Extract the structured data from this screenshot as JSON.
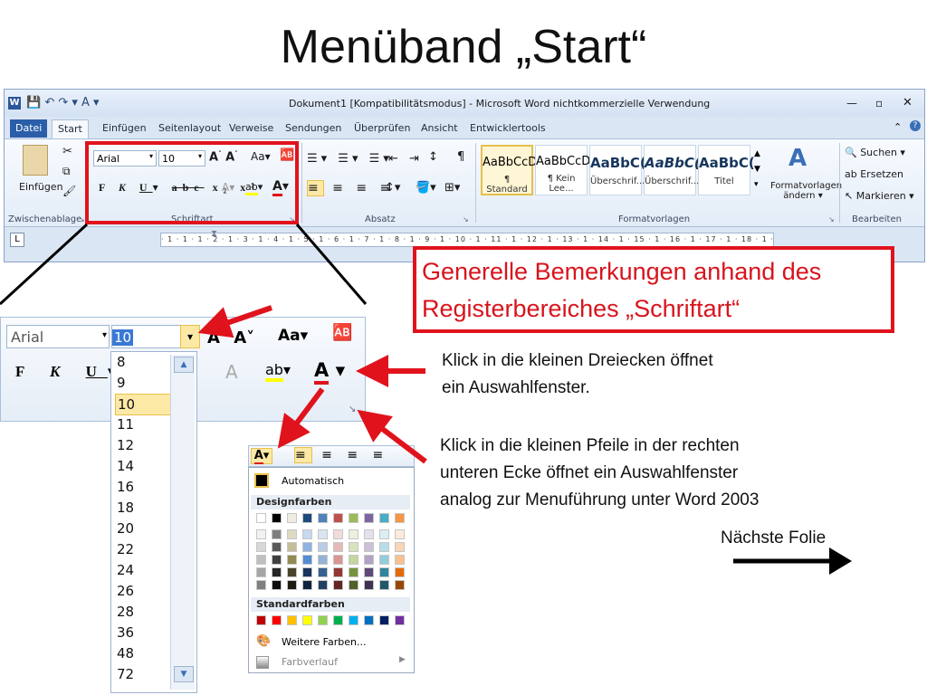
{
  "slide": {
    "title": "Menüband „Start“",
    "callout": [
      "Generelle Bemerkungen anhand des",
      "Registerbereiches „Schriftart“"
    ],
    "note1": [
      "Klick in die kleinen Dreiecken öffnet",
      "ein Auswahlfenster."
    ],
    "note2": [
      "Klick in die kleinen Pfeile in der rechten",
      "unteren Ecke öffnet ein Auswahlfenster",
      "analog zur Menuführung unter Word 2003"
    ],
    "next": "Nächste Folie"
  },
  "window": {
    "title": "Dokument1 [Kompatibilitätsmodus] - Microsoft Word nichtkommerzielle Verwendung",
    "tabs": [
      "Datei",
      "Start",
      "Einfügen",
      "Seitenlayout",
      "Verweise",
      "Sendungen",
      "Überprüfen",
      "Ansicht",
      "Entwicklertools"
    ],
    "active_tab": 1
  },
  "ribbon": {
    "paste": "Einfügen",
    "groups": [
      "Zwischenablage",
      "Schriftart",
      "Absatz",
      "Formatvorlagen",
      "Bearbeiten"
    ],
    "font": "Arial",
    "size": "10",
    "styles": [
      {
        "sample": "AaBbCcD",
        "name": "¶ Standard"
      },
      {
        "sample": "AaBbCcD",
        "name": "¶ Kein Lee..."
      },
      {
        "sample": "AaBbC(",
        "name": "Überschrif..."
      },
      {
        "sample": "AaBbC(",
        "name": "Überschrif..."
      },
      {
        "sample": "AaBbC(",
        "name": "Titel"
      }
    ],
    "change_styles": [
      "Formatvorlagen",
      "ändern"
    ],
    "search": "Suchen",
    "replace": "Ersetzen",
    "select": "Markieren"
  },
  "ruler": "· 1 · 1 · 1 · 2 · 1 · 3 · 1 · 4 · 1 · 5 · 1 · 6 · 1 · 7 · 1 · 8 · 1 · 9 · 1 · 10 · 1 · 11 · 1 · 12 · 1 · 13 · 1 · 14 · 1 · 15 · 1 · 16 · 1 · 17 · 1 · 18 · 1 · 19",
  "zoom": {
    "font": "Arial",
    "size": "10",
    "sizes": [
      "8",
      "9",
      "10",
      "11",
      "12",
      "14",
      "16",
      "18",
      "20",
      "22",
      "24",
      "26",
      "28",
      "36",
      "48",
      "72"
    ],
    "selected": "10"
  },
  "colors": {
    "auto": "Automatisch",
    "design": "Designfarben",
    "standard": "Standardfarben",
    "more": "Weitere Farben...",
    "gradient": "Farbverlauf",
    "theme_top": [
      "#ffffff",
      "#000000",
      "#eeece1",
      "#1f497d",
      "#4f81bd",
      "#c0504d",
      "#9bbb59",
      "#8064a2",
      "#4bacc6",
      "#f79646"
    ],
    "shades": [
      [
        "#f2f2f2",
        "#7f7f7f",
        "#ddd9c3",
        "#c6d9f0",
        "#dbe5f1",
        "#f2dcdb",
        "#ebf1dd",
        "#e5e0ec",
        "#dbeef3",
        "#fdeada"
      ],
      [
        "#d8d8d8",
        "#595959",
        "#c4bd97",
        "#8db3e2",
        "#b8cce4",
        "#e5b9b7",
        "#d7e3bc",
        "#ccc1d9",
        "#b7dde8",
        "#fbd5b5"
      ],
      [
        "#bfbfbf",
        "#3f3f3f",
        "#938953",
        "#548dd4",
        "#95b3d7",
        "#d99694",
        "#c3d69b",
        "#b2a2c7",
        "#92cddc",
        "#fac08f"
      ],
      [
        "#a5a5a5",
        "#262626",
        "#494429",
        "#17365d",
        "#366092",
        "#953734",
        "#76923c",
        "#5f497a",
        "#31859b",
        "#e36c09"
      ],
      [
        "#7f7f7f",
        "#0c0c0c",
        "#1d1b10",
        "#0f243e",
        "#244061",
        "#632423",
        "#4f6128",
        "#3f3151",
        "#205867",
        "#974806"
      ]
    ],
    "standard_row": [
      "#c00000",
      "#ff0000",
      "#ffc000",
      "#ffff00",
      "#92d050",
      "#00b050",
      "#00b0f0",
      "#0070c0",
      "#002060",
      "#7030a0"
    ]
  },
  "accent": "#e0131d"
}
